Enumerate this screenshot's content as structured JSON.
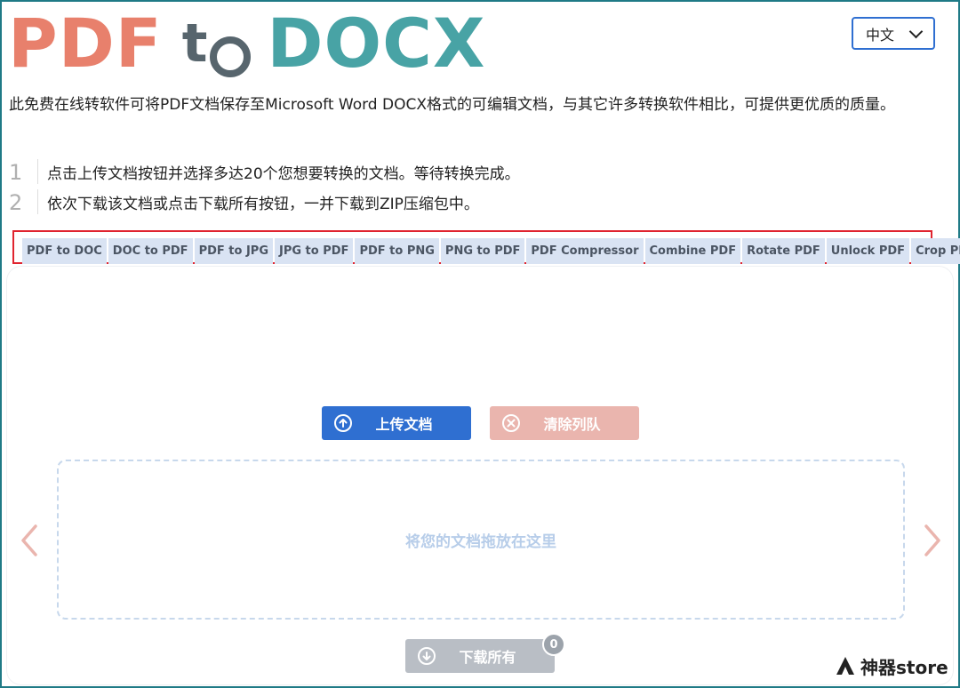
{
  "logo": {
    "part1": "PDF",
    "part2": "t",
    "part3": "DOCX"
  },
  "language_select": {
    "value": "中文"
  },
  "description": "此免费在线转软件可将PDF文档保存至Microsoft Word DOCX格式的可编辑文档，与其它许多转换软件相比，可提供更优质的质量。",
  "steps": [
    {
      "num": "1",
      "text": "点击上传文档按钮并选择多达20个您想要转换的文档。等待转换完成。"
    },
    {
      "num": "2",
      "text": "依次下载该文档或点击下载所有按钮，一并下载到ZIP压缩包中。"
    }
  ],
  "tools": [
    "PDF to DOC",
    "DOC to PDF",
    "PDF to JPG",
    "JPG to PDF",
    "PDF to PNG",
    "PNG to PDF",
    "PDF Compressor",
    "Combine PDF",
    "Rotate PDF",
    "Unlock PDF",
    "Crop PDF"
  ],
  "buttons": {
    "upload": "上传文档",
    "clear": "清除列队",
    "download_all": "下载所有"
  },
  "dropzone": {
    "text": "将您的文档拖放在这里"
  },
  "queue_count": "0",
  "watermark": {
    "text": "神器store"
  },
  "colors": {
    "accent": "#2f6fd1",
    "logo_red": "#e8806c",
    "logo_gray": "#57656d",
    "logo_teal": "#48a3a5",
    "highlight": "#e0242f"
  }
}
